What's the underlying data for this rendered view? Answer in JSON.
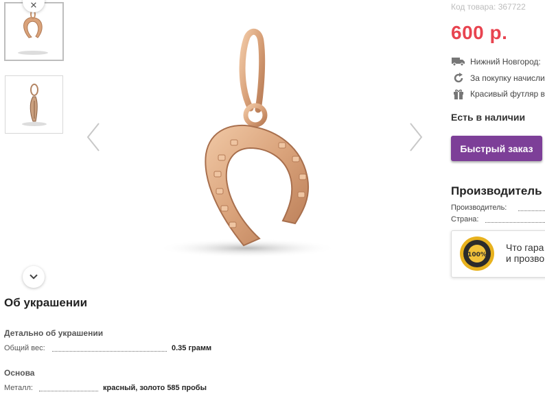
{
  "gallery": {
    "thumbnails": [
      {
        "name": "horseshoe-pendant-front",
        "active": true
      },
      {
        "name": "horseshoe-pendant-side",
        "active": false
      }
    ],
    "icons": {
      "scroll_up": "close-icon",
      "scroll_down": "chevron-down-icon",
      "prev": "chevron-left-icon",
      "next": "chevron-right-icon"
    }
  },
  "product": {
    "sku": "Код товара: 367722",
    "price": "600 р.",
    "features": [
      {
        "icon": "truck-icon",
        "text": "Нижний Новгород:"
      },
      {
        "icon": "refresh-icon",
        "text": "За покупку начисли"
      },
      {
        "icon": "gift-icon",
        "text": "Красивый футляр в"
      }
    ],
    "stock": "Есть в наличии",
    "quick_order": "Быстрый заказ"
  },
  "manufacturer": {
    "title": "Производитель и",
    "rows": [
      {
        "label": "Производитель:",
        "value": ""
      },
      {
        "label": "Страна:",
        "value": ""
      }
    ]
  },
  "guarantee": {
    "badge": "100%",
    "line1": "Что гара",
    "line2": "и прозво"
  },
  "details": {
    "title": "Об украшении",
    "groups": [
      {
        "title": "Детально об украшении",
        "rows": [
          {
            "label": "Общий вес:",
            "value": "0.35 грамм"
          }
        ]
      },
      {
        "title": "Основа",
        "rows": [
          {
            "label": "Металл:",
            "value": "красный, золото 585 пробы"
          }
        ]
      }
    ]
  },
  "colors": {
    "price": "#e84450",
    "button": "#7d3f98",
    "gold": "#d9a27a",
    "badge": "#e8b21e"
  }
}
